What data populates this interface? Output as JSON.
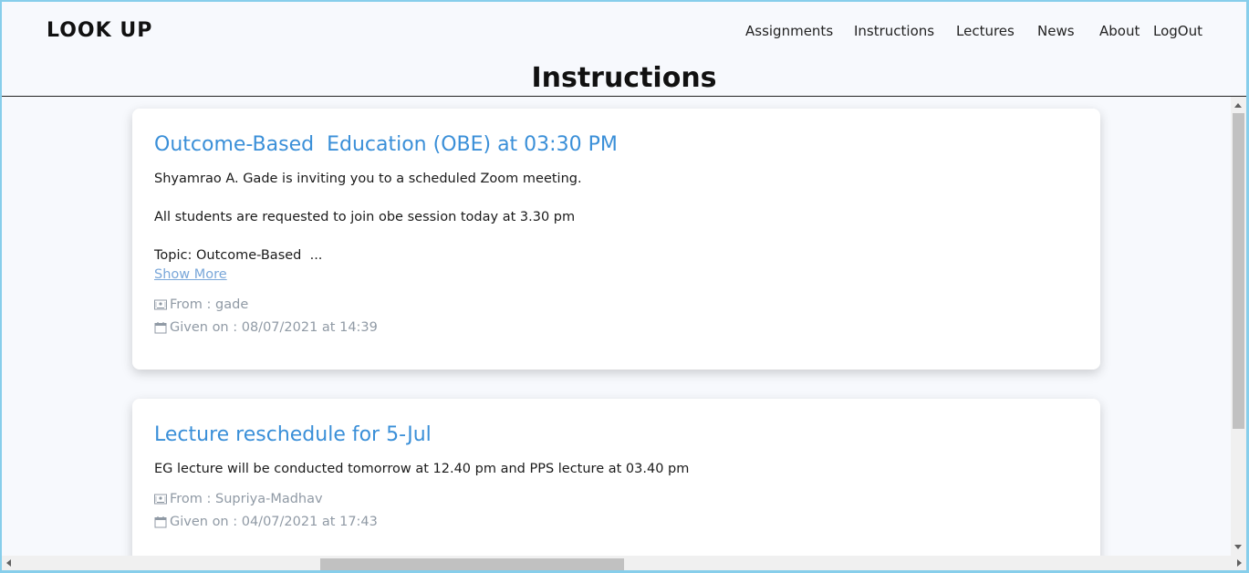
{
  "brand": "LOOK UP",
  "nav": {
    "assignments": "Assignments",
    "instructions": "Instructions",
    "lectures": "Lectures",
    "news": "News",
    "about": "About",
    "logout": "LogOut"
  },
  "page_title": "Instructions",
  "cards": [
    {
      "title": "Outcome-Based  Education (OBE) at 03:30 PM",
      "lines": [
        "Shyamrao A. Gade is inviting you to a scheduled Zoom meeting.",
        "All students are requested to join obe session today at 3.30 pm",
        "Topic: Outcome-Based  ..."
      ],
      "show_more": "Show More",
      "from": "From : gade",
      "given_on": "Given on : 08/07/2021 at 14:39"
    },
    {
      "title": "Lecture reschedule for 5-Jul",
      "lines": [
        "EG lecture will be conducted tomorrow at 12.40 pm and PPS lecture at 03.40 pm"
      ],
      "from": "From : Supriya-Madhav",
      "given_on": "Given on : 04/07/2021 at 17:43"
    }
  ],
  "colors": {
    "accent": "#3a8fd8",
    "link": "#7aa7d9",
    "meta": "#909aa5",
    "background": "#f7f9fd"
  }
}
